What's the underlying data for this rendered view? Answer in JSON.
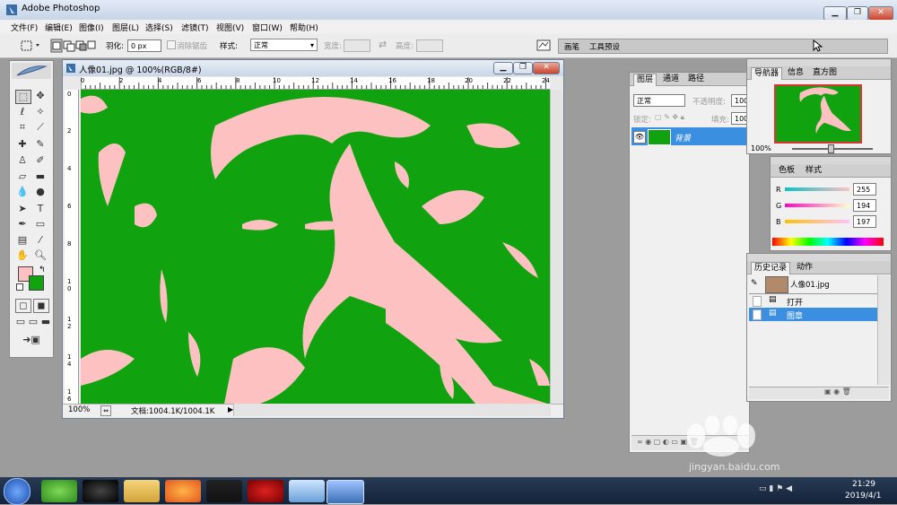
{
  "window": {
    "title": "Adobe Photoshop"
  },
  "menubar": [
    "文件(F)",
    "编辑(E)",
    "图像(I)",
    "图层(L)",
    "选择(S)",
    "滤镜(T)",
    "视图(V)",
    "窗口(W)",
    "帮助(H)"
  ],
  "options": {
    "feather_label": "羽化:",
    "feather_value": "0 px",
    "antialias_label": "消除锯齿",
    "style_label": "样式:",
    "style_value": "正常",
    "width_label": "宽度:",
    "height_label": "高度:",
    "well_tabs": [
      "画笔",
      "工具预设"
    ]
  },
  "document": {
    "title": "人像01.jpg @ 100%(RGB/8#)",
    "ruler_h_labels": [
      "0",
      "2",
      "4",
      "6",
      "8",
      "10",
      "12",
      "14",
      "16",
      "18",
      "20",
      "22",
      "24"
    ],
    "ruler_v_labels": [
      "0",
      "2",
      "4",
      "6",
      "8",
      "1 0",
      "1 2",
      "1 4",
      "1 6"
    ],
    "zoom": "100%",
    "doc_info": "文档:1004.1K/1004.1K",
    "colors": {
      "background": "#11a30f",
      "foreground": "#fdc1c1"
    }
  },
  "layers_panel": {
    "tabs": [
      "图层",
      "通道",
      "路径"
    ],
    "blend_mode": "正常",
    "opacity_label": "不透明度:",
    "opacity_value": "100",
    "lock_label": "锁定:",
    "fill_label": "填充:",
    "fill_value": "100",
    "layer_name": "背景"
  },
  "navigator_panel": {
    "tabs": [
      "导航器",
      "信息",
      "直方图"
    ],
    "zoom": "100%"
  },
  "color_panel": {
    "tabs": [
      "色板",
      "样式"
    ],
    "channels": [
      {
        "label": "R",
        "value": "255",
        "level": 1.0
      },
      {
        "label": "G",
        "value": "194",
        "level": 0.76
      },
      {
        "label": "B",
        "value": "197",
        "level": 0.77
      }
    ]
  },
  "history_panel": {
    "tabs": [
      "历史记录",
      "动作"
    ],
    "snapshot": "人像01.jpg",
    "items": [
      {
        "label": "打开",
        "selected": false
      },
      {
        "label": "图章",
        "selected": true
      }
    ]
  },
  "watermark": {
    "domain": "jingyan.baidu.com"
  },
  "taskbar": {
    "time": "21:29",
    "date": "2019/4/1"
  }
}
